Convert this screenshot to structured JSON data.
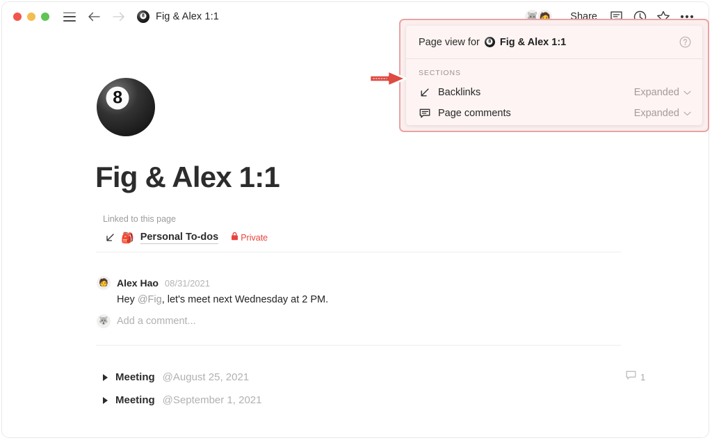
{
  "window": {
    "traffic_lights": [
      "close",
      "minimize",
      "zoom"
    ],
    "sidebar_toggle": "hamburger-icon",
    "back": "back-arrow-icon",
    "forward": "forward-arrow-icon",
    "page_icon": "eight-ball-icon",
    "page_title": "Fig & Alex 1:1"
  },
  "toolbar": {
    "avatar_1": "🐺",
    "avatar_2": "🧑",
    "share_label": "Share",
    "comment_icon": "comment-icon",
    "history_icon": "clock-icon",
    "favorite_icon": "star-icon",
    "more_icon": "more-options-icon"
  },
  "page": {
    "cover_emoji": "eight-ball",
    "title": "Fig & Alex 1:1",
    "linked_label": "Linked to this page",
    "linked_item": {
      "arrow_icon": "arrow-down-left-icon",
      "emoji": "🎒",
      "name": "Personal To-dos",
      "lock_icon": "lock-icon",
      "visibility": "Private"
    },
    "comment": {
      "avatar": "🧑",
      "author": "Alex Hao",
      "date": "08/31/2021",
      "text_before": "Hey ",
      "mention": "@Fig",
      "text_after": ", let's meet next Wednesday at 2 PM."
    },
    "add_comment": {
      "avatar": "🐺",
      "placeholder": "Add a comment..."
    },
    "toggles": [
      {
        "label": "Meeting",
        "date": "@August 25, 2021",
        "comment_count": "1"
      },
      {
        "label": "Meeting",
        "date": "@September 1, 2021",
        "comment_count": ""
      }
    ]
  },
  "popover": {
    "header_prefix": "Page view for",
    "header_icon": "eight-ball-icon",
    "header_title": "Fig & Alex 1:1",
    "help_icon": "help-circle-icon",
    "sections_label": "SECTIONS",
    "rows": [
      {
        "icon": "arrow-down-left-icon",
        "label": "Backlinks",
        "value": "Expanded",
        "chevron": "chevron-down-icon"
      },
      {
        "icon": "comment-icon",
        "label": "Page comments",
        "value": "Expanded",
        "chevron": "chevron-down-icon"
      }
    ]
  },
  "annotation": {
    "arrow_icon": "red-arrow-pointer",
    "arrow_color": "#e04b41"
  },
  "colors": {
    "highlight_border": "#e9a3a3",
    "highlight_fill": "#fbeeee",
    "popover_bg": "#fdf4f3",
    "accent_red": "#e8443b",
    "text_primary": "#2c2c2c",
    "text_muted": "#a9a9a9"
  }
}
